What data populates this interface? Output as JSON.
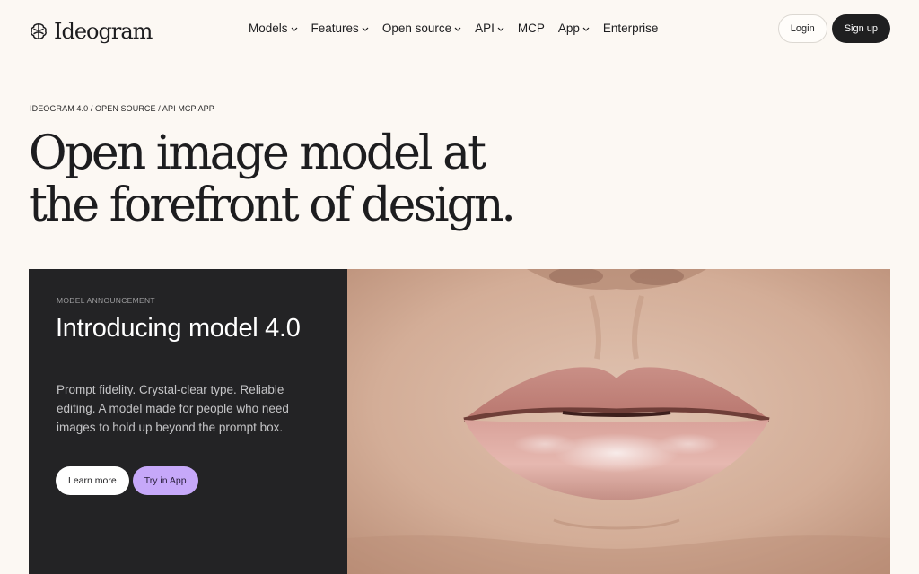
{
  "header": {
    "logo_text": "Ideogram",
    "nav": [
      {
        "label": "Models",
        "has_dropdown": true
      },
      {
        "label": "Features",
        "has_dropdown": true
      },
      {
        "label": "Open source",
        "has_dropdown": true
      },
      {
        "label": "API",
        "has_dropdown": true
      },
      {
        "label": "MCP",
        "has_dropdown": false
      },
      {
        "label": "App",
        "has_dropdown": true
      },
      {
        "label": "Enterprise",
        "has_dropdown": false
      }
    ],
    "login_label": "Login",
    "signup_label": "Sign up"
  },
  "hero": {
    "breadcrumb": "IDEOGRAM 4.0 / OPEN SOURCE / API MCP APP",
    "headline_line1": "Open image model at",
    "headline_line2": "the forefront of design."
  },
  "feature": {
    "eyebrow": "MODEL ANNOUNCEMENT",
    "title": "Introducing model 4.0",
    "description": "Prompt fidelity. Crystal-clear type. Reliable editing. A model made for people who need images to hold up beyond the prompt box.",
    "learn_more_label": "Learn more",
    "try_label": "Try in App",
    "image_subject": "close-up-lips-photo"
  },
  "colors": {
    "page_background": "#fcf8f3",
    "dark_card": "#232325",
    "accent_lilac": "#c6a8f9",
    "signup_button": "#1f1f20"
  }
}
